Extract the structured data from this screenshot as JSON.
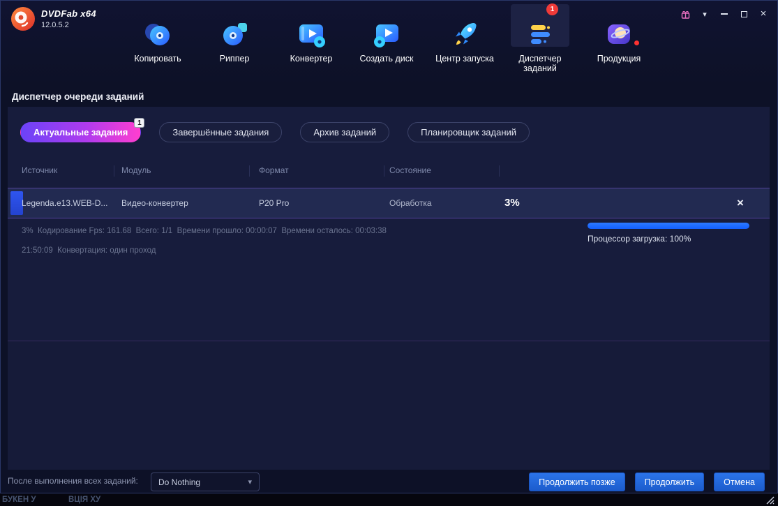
{
  "window": {
    "app_title": "DVDFab x64",
    "version": "12.0.5.2",
    "controls": {
      "dropdown_glyph": "▾",
      "close_glyph": "×"
    }
  },
  "nav": {
    "items": [
      {
        "label": "Копировать"
      },
      {
        "label": "Риппер"
      },
      {
        "label": "Конвертер"
      },
      {
        "label": "Создать диск"
      },
      {
        "label": "Центр запуска"
      },
      {
        "label": "Диспетчер заданий",
        "badge": "1"
      },
      {
        "label": "Продукция"
      }
    ]
  },
  "page": {
    "title": "Диспетчер очереди заданий"
  },
  "queue": {
    "tabs": [
      {
        "label": "Актуальные задания",
        "badge": "1"
      },
      {
        "label": "Завершённые задания"
      },
      {
        "label": "Архив заданий"
      },
      {
        "label": "Планировщик заданий"
      }
    ],
    "columns": [
      "Источник",
      "Модуль",
      "Формат",
      "Состояние"
    ],
    "row": {
      "source": "Legenda.e13.WEB-D...",
      "module": "Видео-конвертер",
      "format": "P20 Pro",
      "state": "Обработка",
      "progress": "3%",
      "close_glyph": "×"
    },
    "details": {
      "line1": "3%  Кодирование Fps: 161.68  Всего: 1/1  Времени прошло: 00:00:07  Времени осталось: 00:03:38",
      "line2": "21:50:09  Конвертация: один проход",
      "cpu_label": "Процессор загрузка: 100%",
      "cpu_percent": 100
    }
  },
  "footer": {
    "after_label": "После выполнения всех заданий:",
    "dropdown_value": "Do Nothing",
    "dropdown_caret": "▾",
    "buttons": [
      {
        "label": "Продолжить позже"
      },
      {
        "label": "Продолжить"
      },
      {
        "label": "Отмена"
      }
    ]
  },
  "background_window": {
    "text1": "БУКЕН У",
    "text2": "ВЦІЯ ХУ"
  }
}
